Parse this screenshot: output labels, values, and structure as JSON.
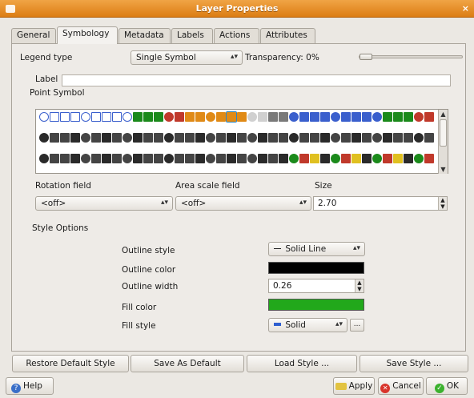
{
  "window": {
    "title": "Layer Properties",
    "close_glyph": "×"
  },
  "tabs": [
    {
      "label": "General"
    },
    {
      "label": "Symbology"
    },
    {
      "label": "Metadata"
    },
    {
      "label": "Labels"
    },
    {
      "label": "Actions"
    },
    {
      "label": "Attributes"
    }
  ],
  "legend": {
    "label": "Legend type",
    "value": "Single Symbol",
    "transparency_label": "Transparency: 0%",
    "transparency_value": 0
  },
  "label_field": {
    "label": "Label",
    "value": ""
  },
  "point_symbol": {
    "label": "Point Symbol",
    "selected_index": 18
  },
  "fields": {
    "rotation_label": "Rotation field",
    "rotation_value": "<off>",
    "area_label": "Area scale field",
    "area_value": "<off>",
    "size_label": "Size",
    "size_value": "2.70"
  },
  "style_options": {
    "heading": "Style Options",
    "outline_style_label": "Outline style",
    "outline_style_value": "Solid Line",
    "outline_color_label": "Outline color",
    "outline_color": "#000000",
    "outline_width_label": "Outline width",
    "outline_width_value": "0.26",
    "fill_color_label": "Fill color",
    "fill_color": "#22a81b",
    "fill_style_label": "Fill style",
    "fill_style_value": "Solid",
    "fill_style_more": "..."
  },
  "bottom_buttons": {
    "restore": "Restore Default Style",
    "save_default": "Save As Default",
    "load": "Load Style ...",
    "save": "Save Style ..."
  },
  "dialog_buttons": {
    "help": "Help",
    "apply": "Apply",
    "cancel": "Cancel",
    "ok": "OK"
  }
}
